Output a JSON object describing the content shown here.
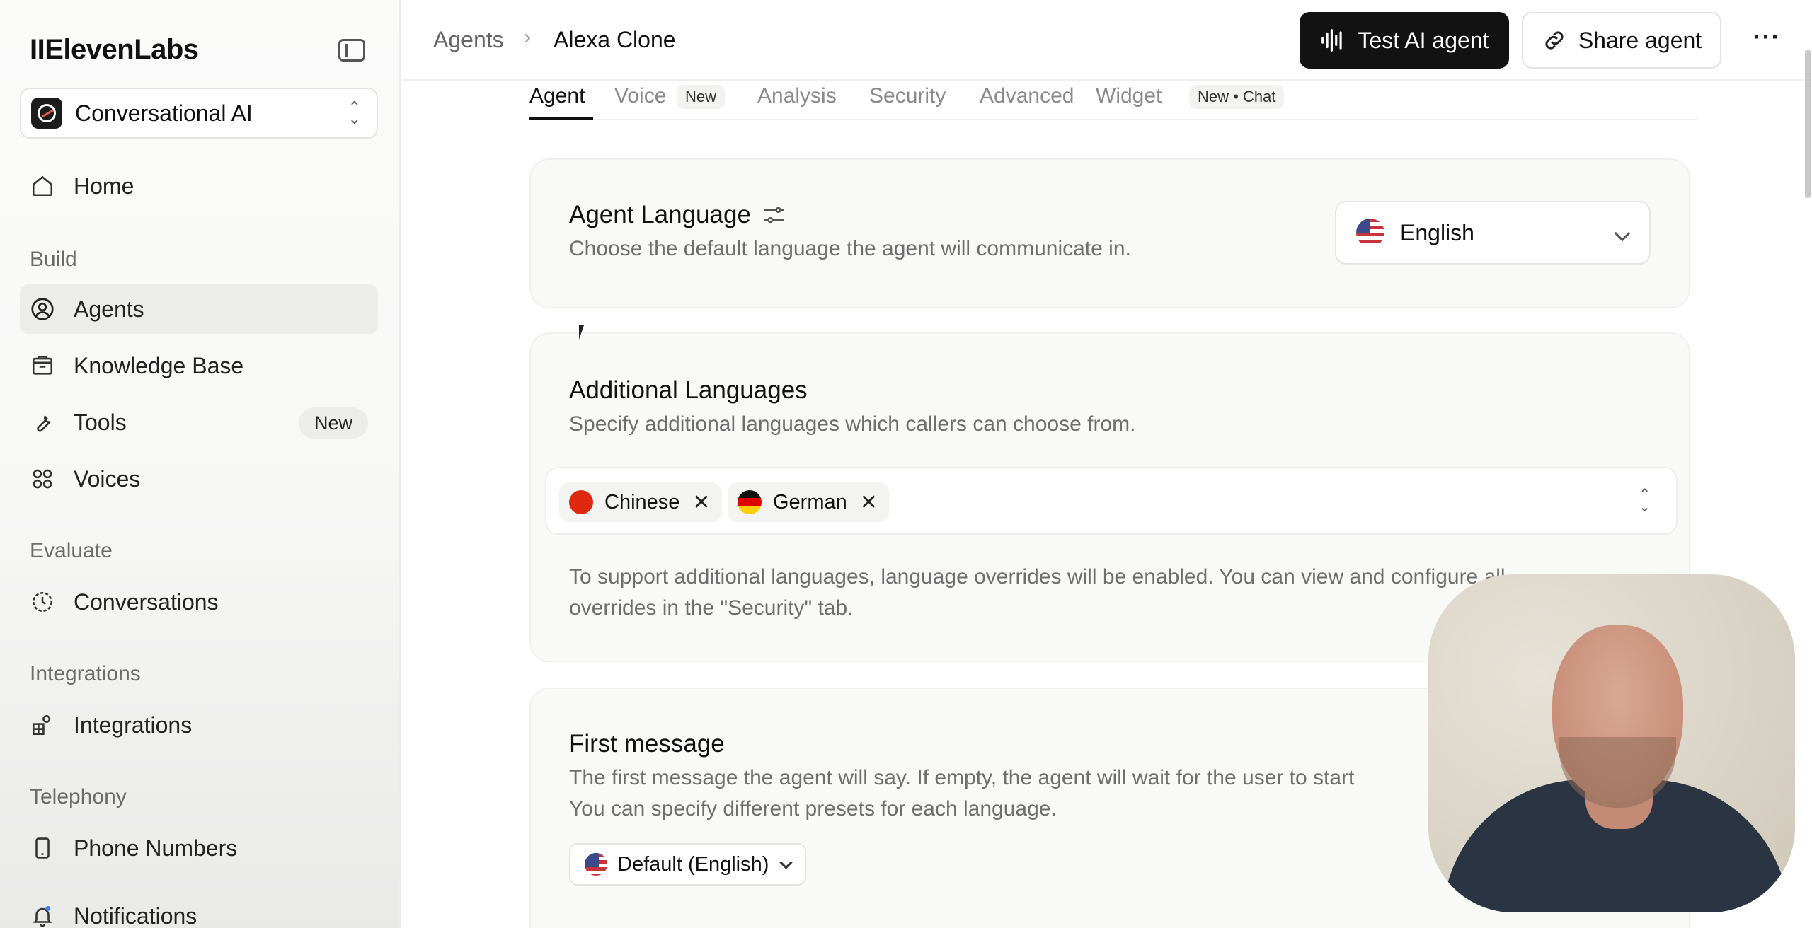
{
  "sidebar": {
    "brand": "IIElevenLabs",
    "workspace": "Conversational AI",
    "items": {
      "home": "Home",
      "agents": "Agents",
      "knowledge_base": "Knowledge Base",
      "tools": "Tools",
      "tools_badge": "New",
      "voices": "Voices",
      "conversations": "Conversations",
      "integrations": "Integrations",
      "phone_numbers": "Phone Numbers",
      "notifications": "Notifications"
    },
    "sections": {
      "build": "Build",
      "evaluate": "Evaluate",
      "integrations": "Integrations",
      "telephony": "Telephony"
    }
  },
  "header": {
    "breadcrumb_parent": "Agents",
    "breadcrumb_separator": "›",
    "breadcrumb_current": "Alexa Clone",
    "test_button": "Test AI agent",
    "share_button": "Share agent",
    "more": "···"
  },
  "tabs": {
    "agent": "Agent",
    "voice": "Voice",
    "voice_badge": "New",
    "analysis": "Analysis",
    "security": "Security",
    "advanced": "Advanced",
    "widget": "Widget",
    "widget_badge": "New • Chat"
  },
  "agent_language": {
    "title": "Agent Language",
    "description": "Choose the default language the agent will communicate in.",
    "selected": "English"
  },
  "additional_languages": {
    "title": "Additional Languages",
    "description": "Specify additional languages which callers can choose from.",
    "chips": [
      "Chinese",
      "German"
    ],
    "note_line1": "To support additional languages, language overrides will be enabled. You can view and configure all",
    "note_line2": "overrides in the \"Security\" tab."
  },
  "first_message": {
    "title": "First message",
    "description_line1": "The first message the agent will say. If empty, the agent will wait for the user to start",
    "description_line2": "You can specify different presets for each language.",
    "preset": "Default (English)"
  },
  "colors": {
    "accent": "#121212",
    "card_bg": "#f9f9f8",
    "muted_text": "#6e6e6e"
  }
}
